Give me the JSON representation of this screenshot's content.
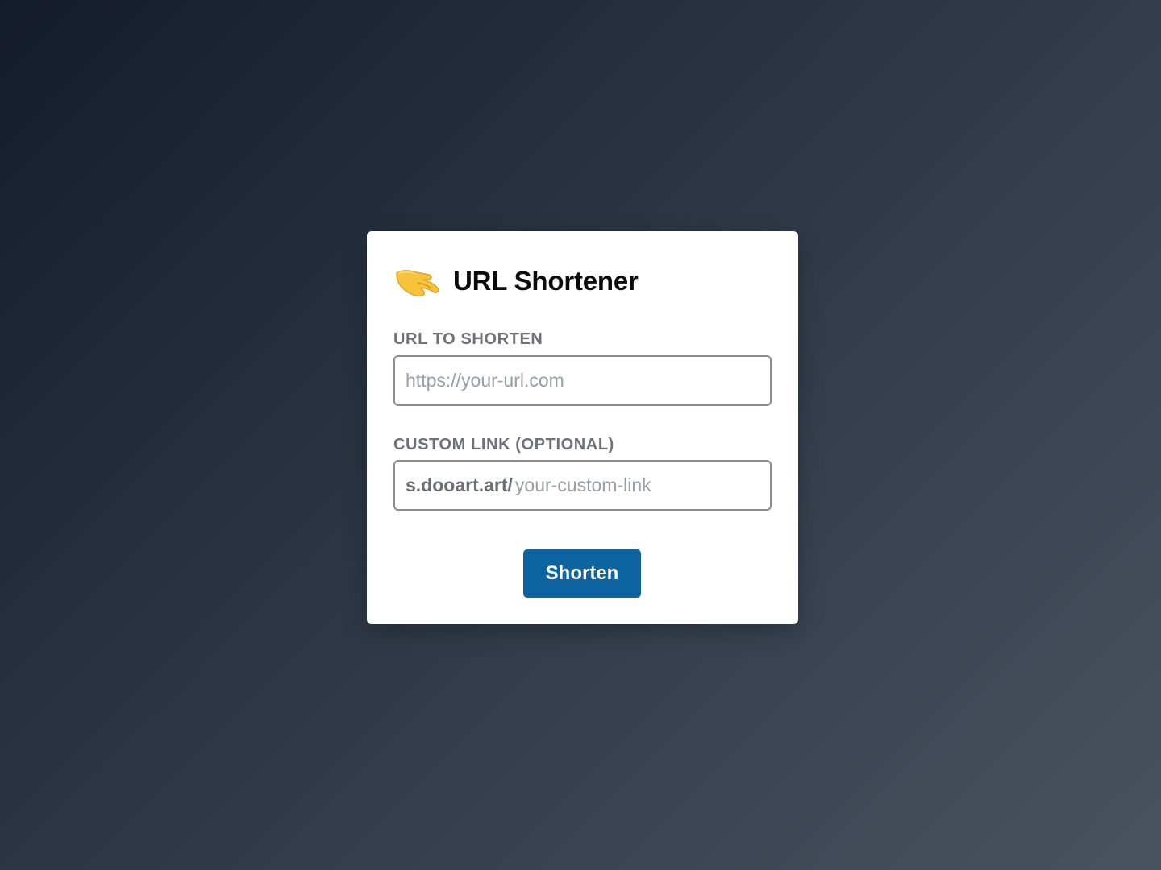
{
  "app": {
    "title": "URL Shortener",
    "icon": "pinching-hand-icon"
  },
  "form": {
    "url_label": "URL TO SHORTEN",
    "url_placeholder": "https://your-url.com",
    "url_value": "",
    "custom_label": "CUSTOM LINK (OPTIONAL)",
    "custom_prefix": "s.dooart.art/",
    "custom_placeholder": "your-custom-link",
    "custom_value": "",
    "submit_label": "Shorten"
  },
  "colors": {
    "accent": "#0d64a0",
    "label": "#6f7078",
    "border": "#8a8c93"
  }
}
